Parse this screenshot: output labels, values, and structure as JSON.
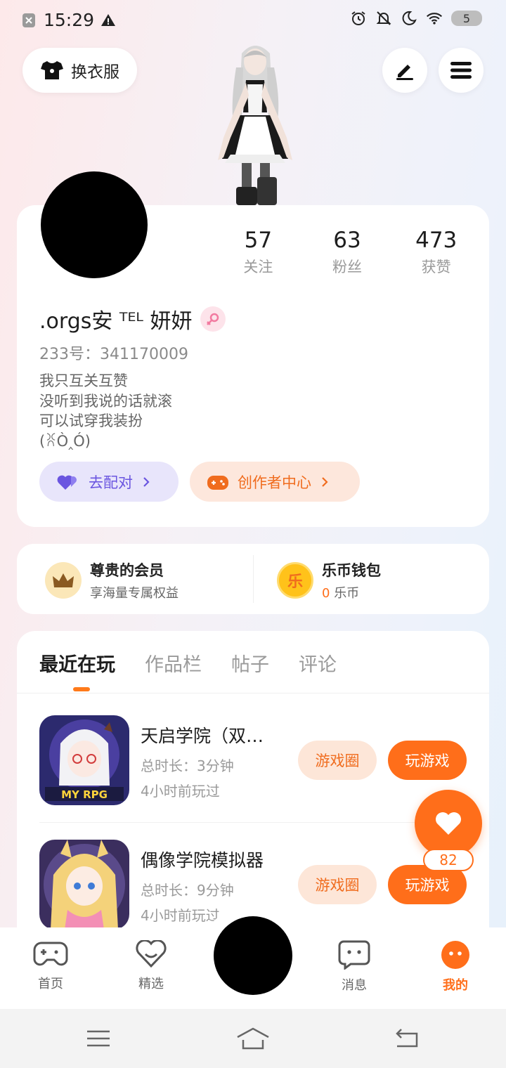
{
  "status_bar": {
    "time": "15:29",
    "battery": "5",
    "icons": [
      "notification-x-icon",
      "warning-icon",
      "alarm-icon",
      "bell-off-icon",
      "moon-icon",
      "wifi-icon"
    ]
  },
  "header": {
    "dress_button": "换衣服",
    "edit_icon": "pen-icon",
    "menu_icon": "hamburger-icon"
  },
  "profile": {
    "stats": [
      {
        "value": "57",
        "label": "关注"
      },
      {
        "value": "63",
        "label": "粉丝"
      },
      {
        "value": "473",
        "label": "获赞"
      }
    ],
    "username": ".orgs安 ᵀᴱᴸ 妍妍",
    "uid": "233号：341170009",
    "bio": [
      "我只互关互赞",
      "没听到我说的话就滚",
      "可以试穿我装扮",
      "(ꐦÒ‸Ó)"
    ],
    "buttons": {
      "match": "去配对",
      "creator": "创作者中心"
    }
  },
  "vip": {
    "member_title": "尊贵的会员",
    "member_sub": "享海量专属权益",
    "wallet_title": "乐币钱包",
    "wallet_amount": "0",
    "wallet_unit": "乐币",
    "coin_glyph": "乐"
  },
  "tabs": [
    "最近在玩",
    "作品栏",
    "帖子",
    "评论"
  ],
  "games": [
    {
      "title": "天启学院（双…",
      "duration": "总时长：3分钟",
      "last_played": "4小时前玩过",
      "thumb_text": "MY RPG",
      "circle_button": "游戏圈",
      "play_button": "玩游戏"
    },
    {
      "title": "偶像学院模拟器",
      "duration": "总时长：9分钟",
      "last_played": "4小时前玩过",
      "circle_button": "游戏圈",
      "play_button": "玩游戏"
    }
  ],
  "fab": {
    "badge": "82"
  },
  "bottom_nav": [
    {
      "label": "首页",
      "icon": "gamepad-icon"
    },
    {
      "label": "精选",
      "icon": "heart-chat-icon"
    },
    {
      "label": "消息",
      "icon": "message-icon"
    },
    {
      "label": "我的",
      "icon": "profile-face-icon"
    }
  ],
  "colors": {
    "accent": "#ff6e1a",
    "match_purple": "#6a55e0",
    "creator_orange": "#f06c1e"
  }
}
